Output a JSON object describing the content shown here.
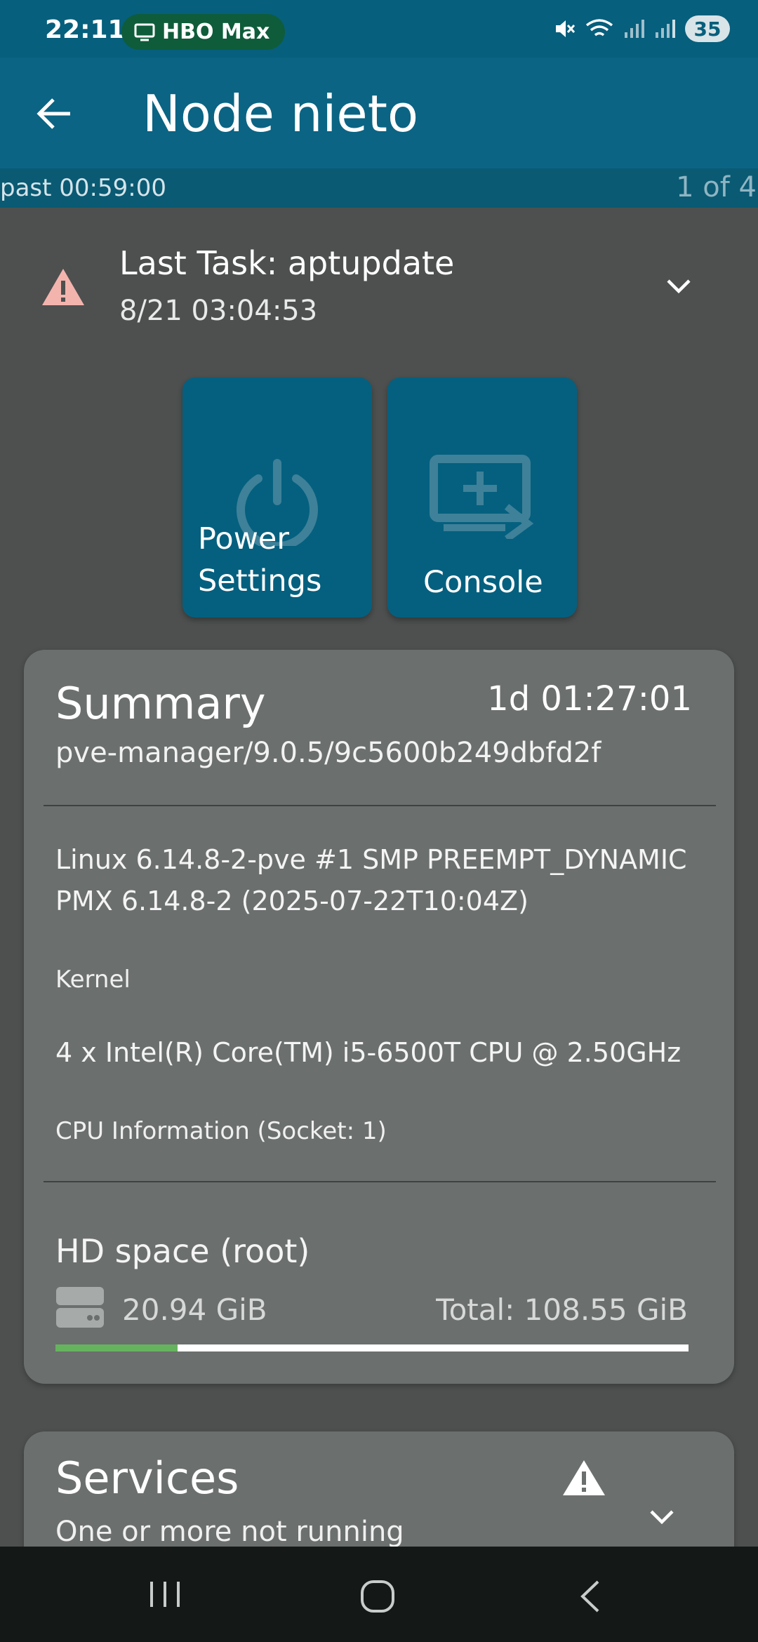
{
  "status_bar": {
    "time": "22:11",
    "pill_label": "HBO Max",
    "battery": "35"
  },
  "app_bar": {
    "title": "Node nieto"
  },
  "sub_strip": {
    "past_label": "past 00:59:00",
    "page_count": "1 of 4"
  },
  "task": {
    "title": "Last Task: aptupdate",
    "time": "8/21 03:04:53"
  },
  "actions": {
    "power_label_line1": "Power",
    "power_label_line2": "Settings",
    "console_label": "Console"
  },
  "summary": {
    "title": "Summary",
    "uptime": "1d 01:27:01",
    "version": "pve-manager/9.0.5/9c5600b249dbfd2f",
    "kernel_text": "Linux 6.14.8-2-pve #1 SMP PREEMPT_DYNAMIC PMX 6.14.8-2 (2025-07-22T10:04Z)",
    "kernel_label": "Kernel",
    "cpu_text": "4 x Intel(R) Core(TM) i5-6500T CPU @ 2.50GHz",
    "cpu_label": "CPU Information (Socket: 1)",
    "hd_title": "HD space (root)",
    "hd_used": "20.94 GiB",
    "hd_total": "Total: 108.55 GiB",
    "hd_used_fraction": 0.193
  },
  "services": {
    "title": "Services",
    "subtitle": "One or more not running"
  },
  "colors": {
    "primary": "#0b6483",
    "background": "#4d504f",
    "card": "#6b6f6e",
    "progress": "#66b35e",
    "warning_icon": "#f4b4ae"
  },
  "icons": {
    "back": "arrow-left-icon",
    "task_warning": "warning-triangle-icon",
    "power": "power-icon",
    "console": "console-icon",
    "disk": "hard-drive-icon"
  }
}
